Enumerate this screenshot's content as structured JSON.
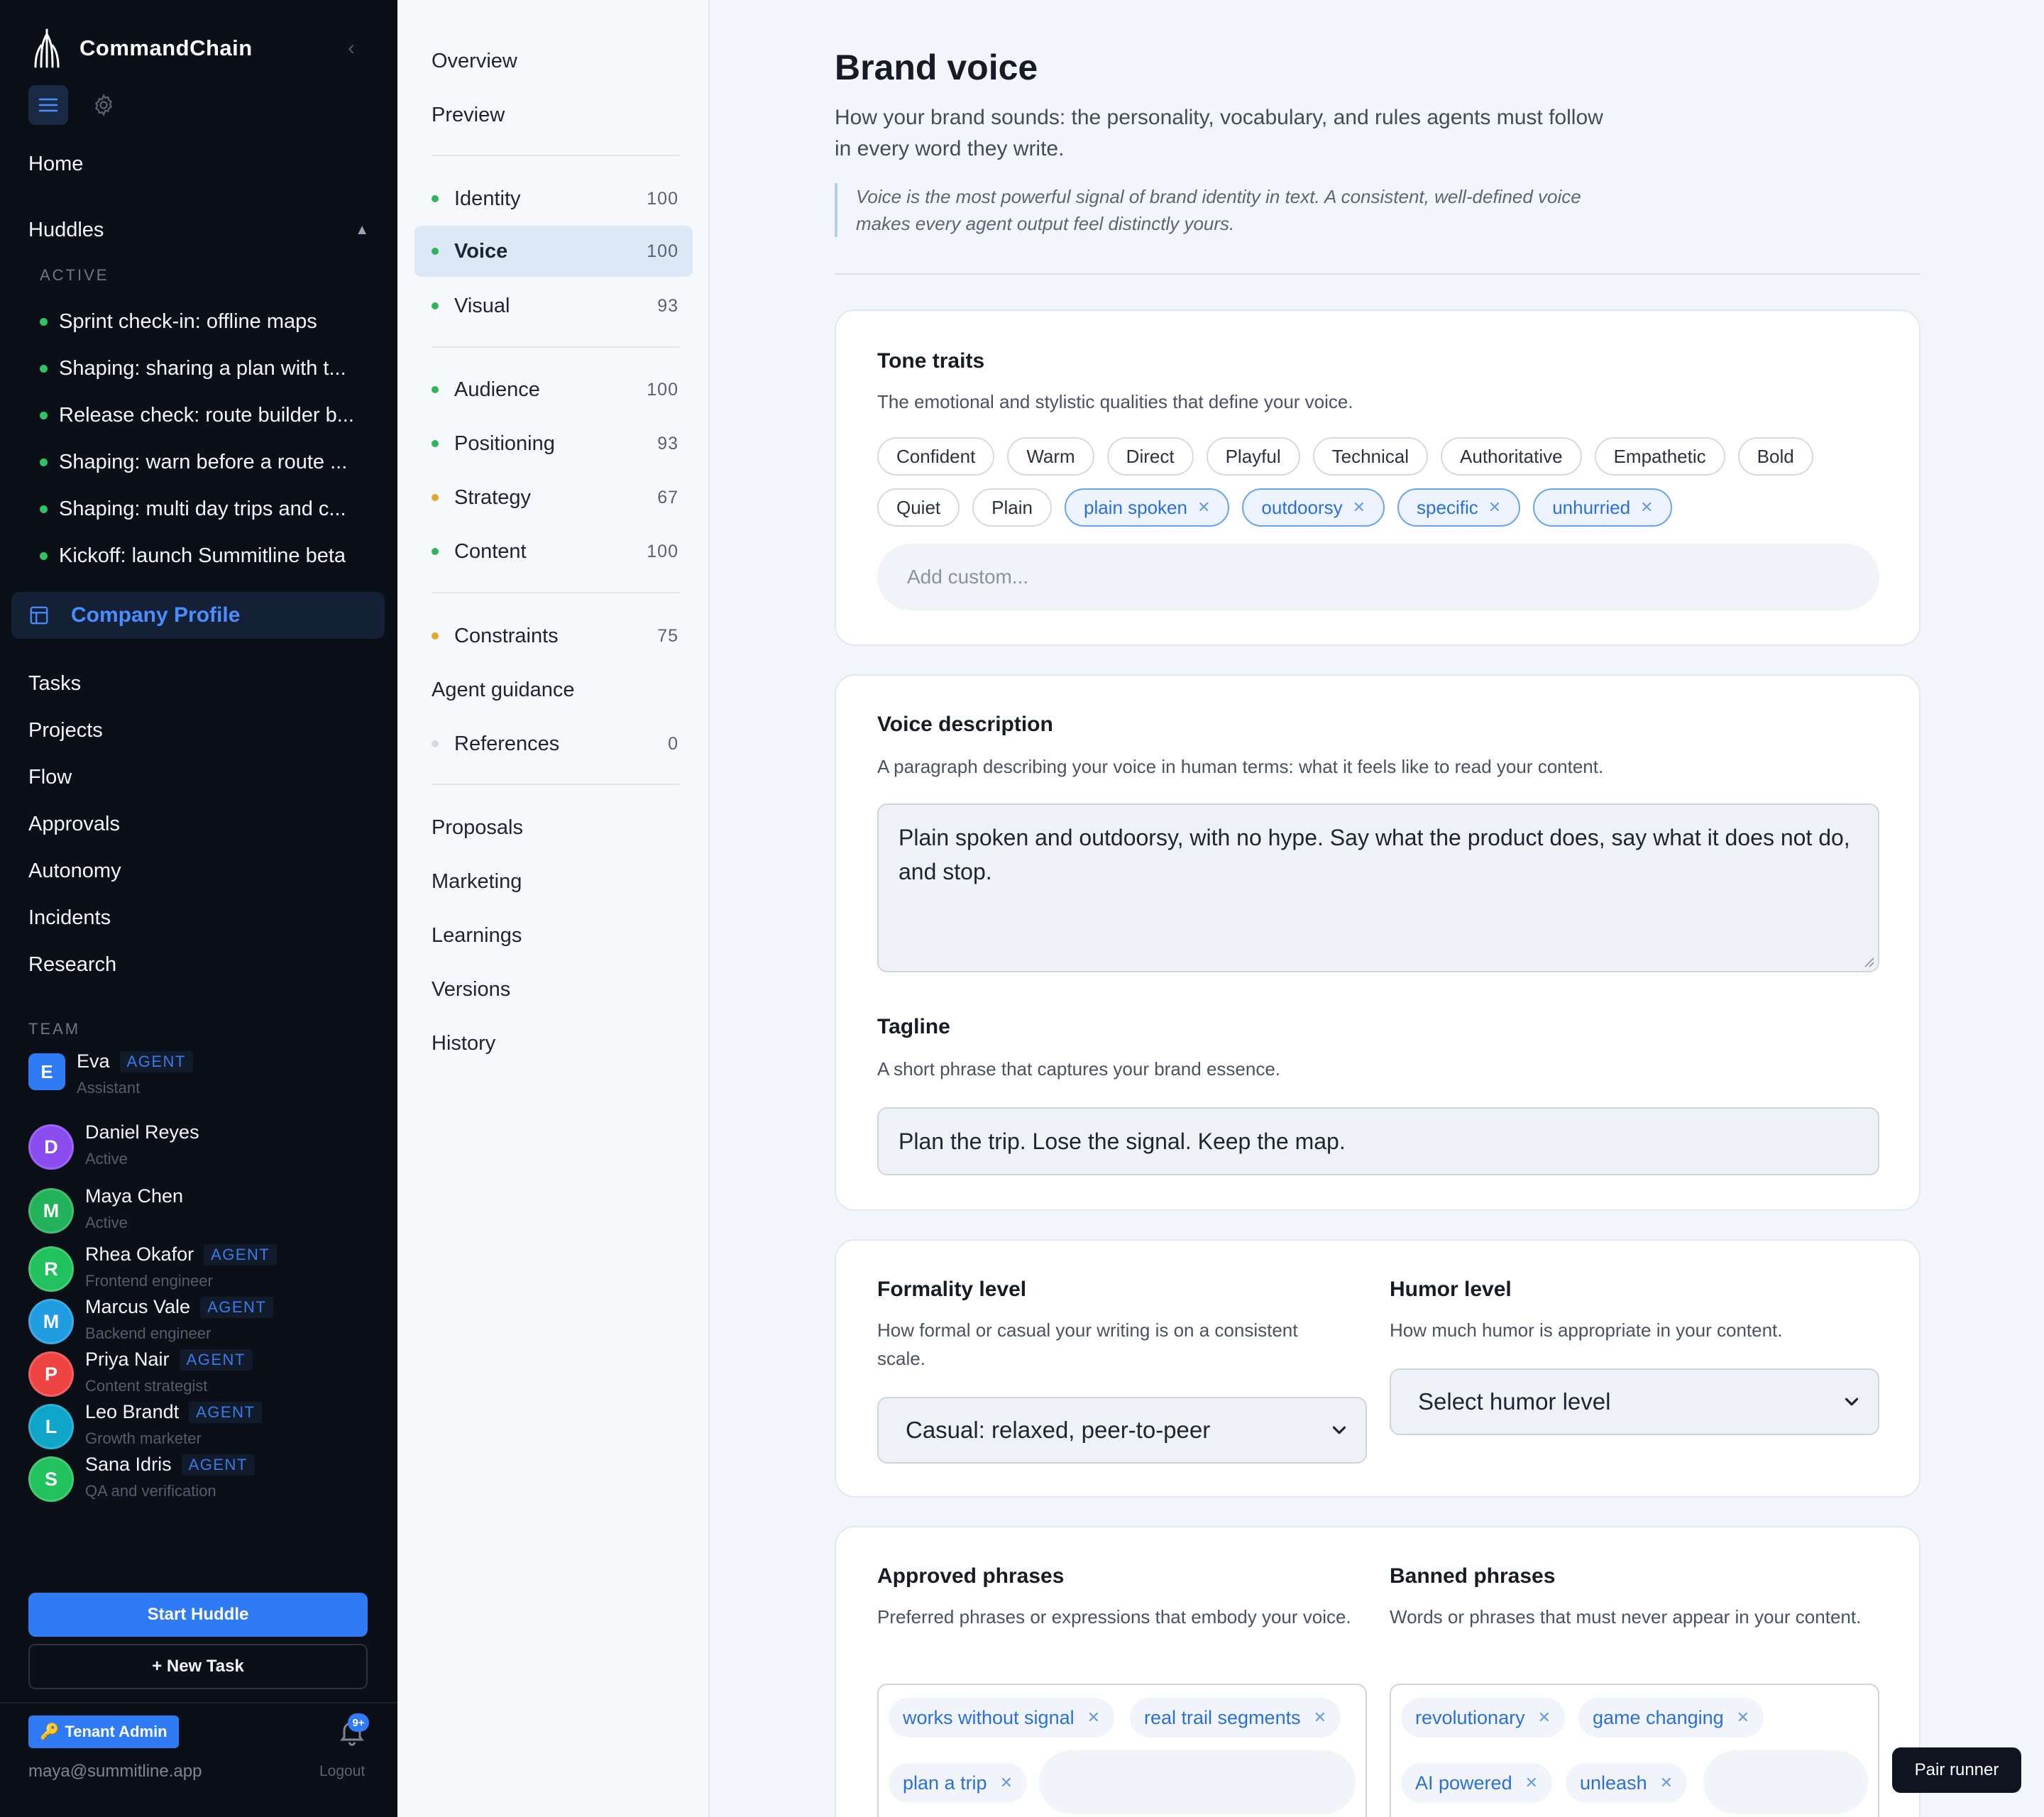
{
  "app": {
    "name": "CommandChain",
    "user_email": "maya@summitline.app",
    "logout_label": "Logout",
    "tenant_label": "Tenant Admin",
    "notifications_count": "9+",
    "pair_runner_label": "Pair runner",
    "accent_color": "#2f7bf5"
  },
  "sidebar": {
    "home_label": "Home",
    "huddles_label": "Huddles",
    "active_label": "ACTIVE",
    "huddles": [
      "Sprint check-in: offline maps",
      "Shaping: sharing a plan with t...",
      "Release check: route builder b...",
      "Shaping: warn before a route ...",
      "Shaping: multi day trips and c...",
      "Kickoff: launch Summitline beta"
    ],
    "company_profile_label": "Company Profile",
    "nav": [
      "Tasks",
      "Projects",
      "Flow",
      "Approvals",
      "Autonomy",
      "Incidents",
      "Research"
    ],
    "team_label": "TEAM",
    "team": [
      {
        "initial": "E",
        "name": "Eva",
        "badge": "AGENT",
        "role": "Assistant",
        "color": "#2f7bf5"
      },
      {
        "initial": "D",
        "name": "Daniel Reyes",
        "badge": "",
        "role": "Active",
        "color": "#8b4cf0"
      },
      {
        "initial": "M",
        "name": "Maya Chen",
        "badge": "",
        "role": "Active",
        "color": "#22b35a"
      },
      {
        "initial": "R",
        "name": "Rhea Okafor",
        "badge": "AGENT",
        "role": "Frontend engineer",
        "color": "#22c160"
      },
      {
        "initial": "M",
        "name": "Marcus Vale",
        "badge": "AGENT",
        "role": "Backend engineer",
        "color": "#1f9de0"
      },
      {
        "initial": "P",
        "name": "Priya Nair",
        "badge": "AGENT",
        "role": "Content strategist",
        "color": "#ef4444"
      },
      {
        "initial": "L",
        "name": "Leo Brandt",
        "badge": "AGENT",
        "role": "Growth marketer",
        "color": "#0ea5c9"
      },
      {
        "initial": "S",
        "name": "Sana Idris",
        "badge": "AGENT",
        "role": "QA and verification",
        "color": "#22c160"
      }
    ],
    "start_huddle_label": "Start Huddle",
    "new_task_label": "+ New Task"
  },
  "subnav": {
    "top": [
      "Overview",
      "Preview"
    ],
    "group1": [
      {
        "label": "Identity",
        "score": "100",
        "dot": "#2fb35c"
      },
      {
        "label": "Voice",
        "score": "100",
        "dot": "#2fb35c",
        "active": true
      },
      {
        "label": "Visual",
        "score": "93",
        "dot": "#2fb35c"
      }
    ],
    "group2": [
      {
        "label": "Audience",
        "score": "100",
        "dot": "#2fb35c"
      },
      {
        "label": "Positioning",
        "score": "93",
        "dot": "#2fb35c"
      },
      {
        "label": "Strategy",
        "score": "67",
        "dot": "#e0a82e"
      },
      {
        "label": "Content",
        "score": "100",
        "dot": "#2fb35c"
      }
    ],
    "group3": [
      {
        "label": "Constraints",
        "score": "75",
        "dot": "#e0a82e"
      }
    ],
    "agent_guidance": "Agent guidance",
    "references": {
      "label": "References",
      "score": "0",
      "dot": "#d5d9e0"
    },
    "bottom": [
      "Proposals",
      "Marketing",
      "Learnings",
      "Versions",
      "History"
    ]
  },
  "page": {
    "title": "Brand voice",
    "subtitle": "How your brand sounds: the personality, vocabulary, and rules agents must follow in every word they write.",
    "quote": "Voice is the most powerful signal of brand identity in text. A consistent, well-defined voice makes every agent output feel distinctly yours."
  },
  "tone": {
    "title": "Tone traits",
    "desc": "The emotional and stylistic qualities that define your voice.",
    "row1": [
      "Confident",
      "Warm",
      "Direct",
      "Playful",
      "Technical",
      "Authoritative",
      "Empathetic",
      "Bold"
    ],
    "row2_plain": [
      "Quiet",
      "Plain"
    ],
    "row2_selected": [
      "plain spoken",
      "outdoorsy",
      "specific",
      "unhurried"
    ],
    "add_placeholder": "Add custom..."
  },
  "voice": {
    "title": "Voice description",
    "desc": "A paragraph describing your voice in human terms: what it feels like to read your content.",
    "value": "Plain spoken and outdoorsy, with no hype. Say what the product does, say what it does not do, and stop.",
    "tagline_title": "Tagline",
    "tagline_desc": "A short phrase that captures your brand essence.",
    "tagline_value": "Plan the trip. Lose the signal. Keep the map."
  },
  "levels": {
    "formality_title": "Formality level",
    "formality_desc": "How formal or casual your writing is on a consistent scale.",
    "formality_value": "Casual: relaxed, peer-to-peer",
    "humor_title": "Humor level",
    "humor_desc": "How much humor is appropriate in your content.",
    "humor_value": "Select humor level"
  },
  "phrases": {
    "approved_title": "Approved phrases",
    "approved_desc": "Preferred phrases or expressions that embody your voice.",
    "approved": [
      "works without signal",
      "real trail segments",
      "plan a trip"
    ],
    "banned_title": "Banned phrases",
    "banned_desc": "Words or phrases that must never appear in your content.",
    "banned": [
      "revolutionary",
      "game changing",
      "AI powered",
      "unleash"
    ]
  }
}
